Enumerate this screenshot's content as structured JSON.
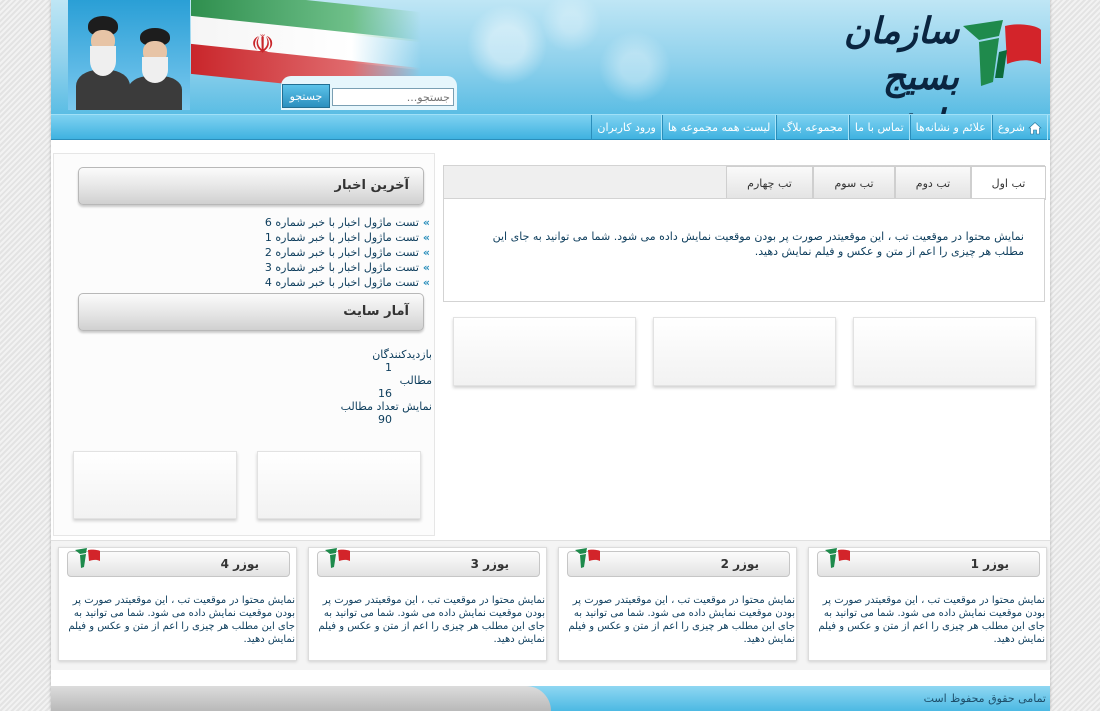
{
  "header": {
    "site_title": "سازمان بسیج دانشجویی",
    "search": {
      "placeholder": "جستجو...",
      "button_label": "جستجو"
    }
  },
  "nav": {
    "items": [
      {
        "label": "شروع",
        "icon": "home-icon"
      },
      {
        "label": "علائم و نشانه‌ها"
      },
      {
        "label": "تماس با ما"
      },
      {
        "label": "مجموعه بلاگ"
      },
      {
        "label": "لیست همه مجموعه ها"
      },
      {
        "label": "ورود کاربران"
      }
    ]
  },
  "sidebar": {
    "latest_news": {
      "title": "آخرین اخبار",
      "items": [
        "تست ماژول اخبار با خبر شماره 6",
        "تست ماژول اخبار با خبر شماره 1",
        "تست ماژول اخبار با خبر شماره 2",
        "تست ماژول اخبار با خبر شماره 3",
        "تست ماژول اخبار با خبر شماره 4"
      ]
    },
    "site_stats": {
      "title": "آمار سایت",
      "rows": [
        {
          "label": "بازدیدکنندگان",
          "value": "1"
        },
        {
          "label": "مطالب",
          "value": "16"
        },
        {
          "label": "نمایش تعداد مطالب",
          "value": "90"
        }
      ]
    }
  },
  "tabs": {
    "labels": [
      "تب اول",
      "تب دوم",
      "تب سوم",
      "تب چهارم"
    ],
    "active_index": 0,
    "content": "نمایش محتوا در موقعیت تب ، این موقعیتدر صورت پر بودن موقعیت نمایش داده می شود. شما می توانید به جای این مطلب هر چیزی را اعم از متن و عکس و فیلم نمایش دهید."
  },
  "users": [
    {
      "title": "یوزر 1",
      "text": "نمایش محتوا در موقعیت تب ، این موقعیتدر صورت پر بودن موقعیت نمایش داده می شود. شما می توانید به جای این مطلب هر چیزی را اعم از متن و عکس و فیلم نمایش دهید."
    },
    {
      "title": "یوزر 2",
      "text": "نمایش محتوا در موقعیت تب ، این موقعیتدر صورت پر بودن موقعیت نمایش داده می شود. شما می توانید به جای این مطلب هر چیزی را اعم از متن و عکس و فیلم نمایش دهید."
    },
    {
      "title": "یوزر 3",
      "text": "نمایش محتوا در موقعیت تب ، این موقعیتدر صورت پر بودن موقعیت نمایش داده می شود. شما می توانید به جای این مطلب هر چیزی را اعم از متن و عکس و فیلم نمایش دهید."
    },
    {
      "title": "یوزر 4",
      "text": "نمایش محتوا در موقعیت تب ، این موقعیتدر صورت پر بودن موقعیت نمایش داده می شود. شما می توانید به جای این مطلب هر چیزی را اعم از متن و عکس و فیلم نمایش دهید."
    }
  ],
  "footer": {
    "copyright": "تمامی حقوق محفوظ است"
  },
  "colors": {
    "brand_blue": "#3fb2e0",
    "text_navy": "#0d3d5c",
    "logo_green": "#1f8a4c",
    "logo_red": "#d3242a"
  }
}
